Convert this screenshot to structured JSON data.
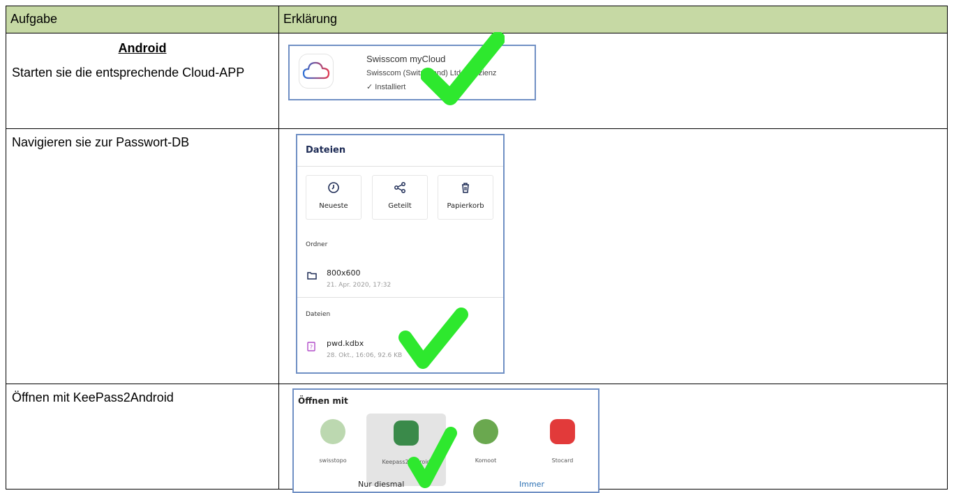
{
  "header": {
    "col1": "Aufgabe",
    "col2": "Erklärung"
  },
  "rows": [
    {
      "heading": "Android",
      "task": "Starten sie die entsprechende Cloud-APP",
      "shot": {
        "app_name": "Swisscom myCloud",
        "developer": "Swisscom (Switzerland) Ltd • Effizienz",
        "status": "✓ Installiert"
      }
    },
    {
      "task": "Navigieren sie zur Passwort-DB",
      "shot": {
        "title": "Dateien",
        "quick_actions": [
          "Neueste",
          "Geteilt",
          "Papierkorb"
        ],
        "folders_label": "Ordner",
        "folder": {
          "name": "800x600",
          "meta": "21. Apr. 2020, 17:32"
        },
        "files_label": "Dateien",
        "file": {
          "name": "pwd.kdbx",
          "meta": "28. Okt., 16:06, 92.6 KB"
        }
      }
    },
    {
      "task": "Öffnen mit KeePass2Android",
      "shot": {
        "title": "Öffnen mit",
        "apps": [
          "swisstopo",
          "Keepass2Android",
          "Komoot",
          "Stocard"
        ],
        "just_once": "Nur diesmal",
        "always": "Immer"
      }
    }
  ],
  "colors": {
    "header_bg": "#c6d9a4",
    "check": "#2ee82e",
    "screenshot_border": "#6f8fc4"
  }
}
